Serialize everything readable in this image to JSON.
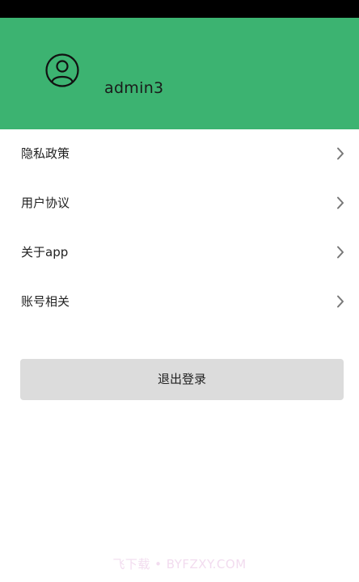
{
  "header": {
    "avatar_icon": "user-circle-icon",
    "username": "admin3",
    "background_color": "#3cb371"
  },
  "menu": {
    "items": [
      {
        "label": "隐私政策",
        "icon": "chevron-right-icon"
      },
      {
        "label": "用户协议",
        "icon": "chevron-right-icon"
      },
      {
        "label": "关于app",
        "icon": "chevron-right-icon"
      },
      {
        "label": "账号相关",
        "icon": "chevron-right-icon"
      }
    ]
  },
  "logout": {
    "label": "退出登录",
    "background_color": "#dcdcdc"
  },
  "watermark": {
    "text": "飞下载 • BYFZXY.COM"
  }
}
